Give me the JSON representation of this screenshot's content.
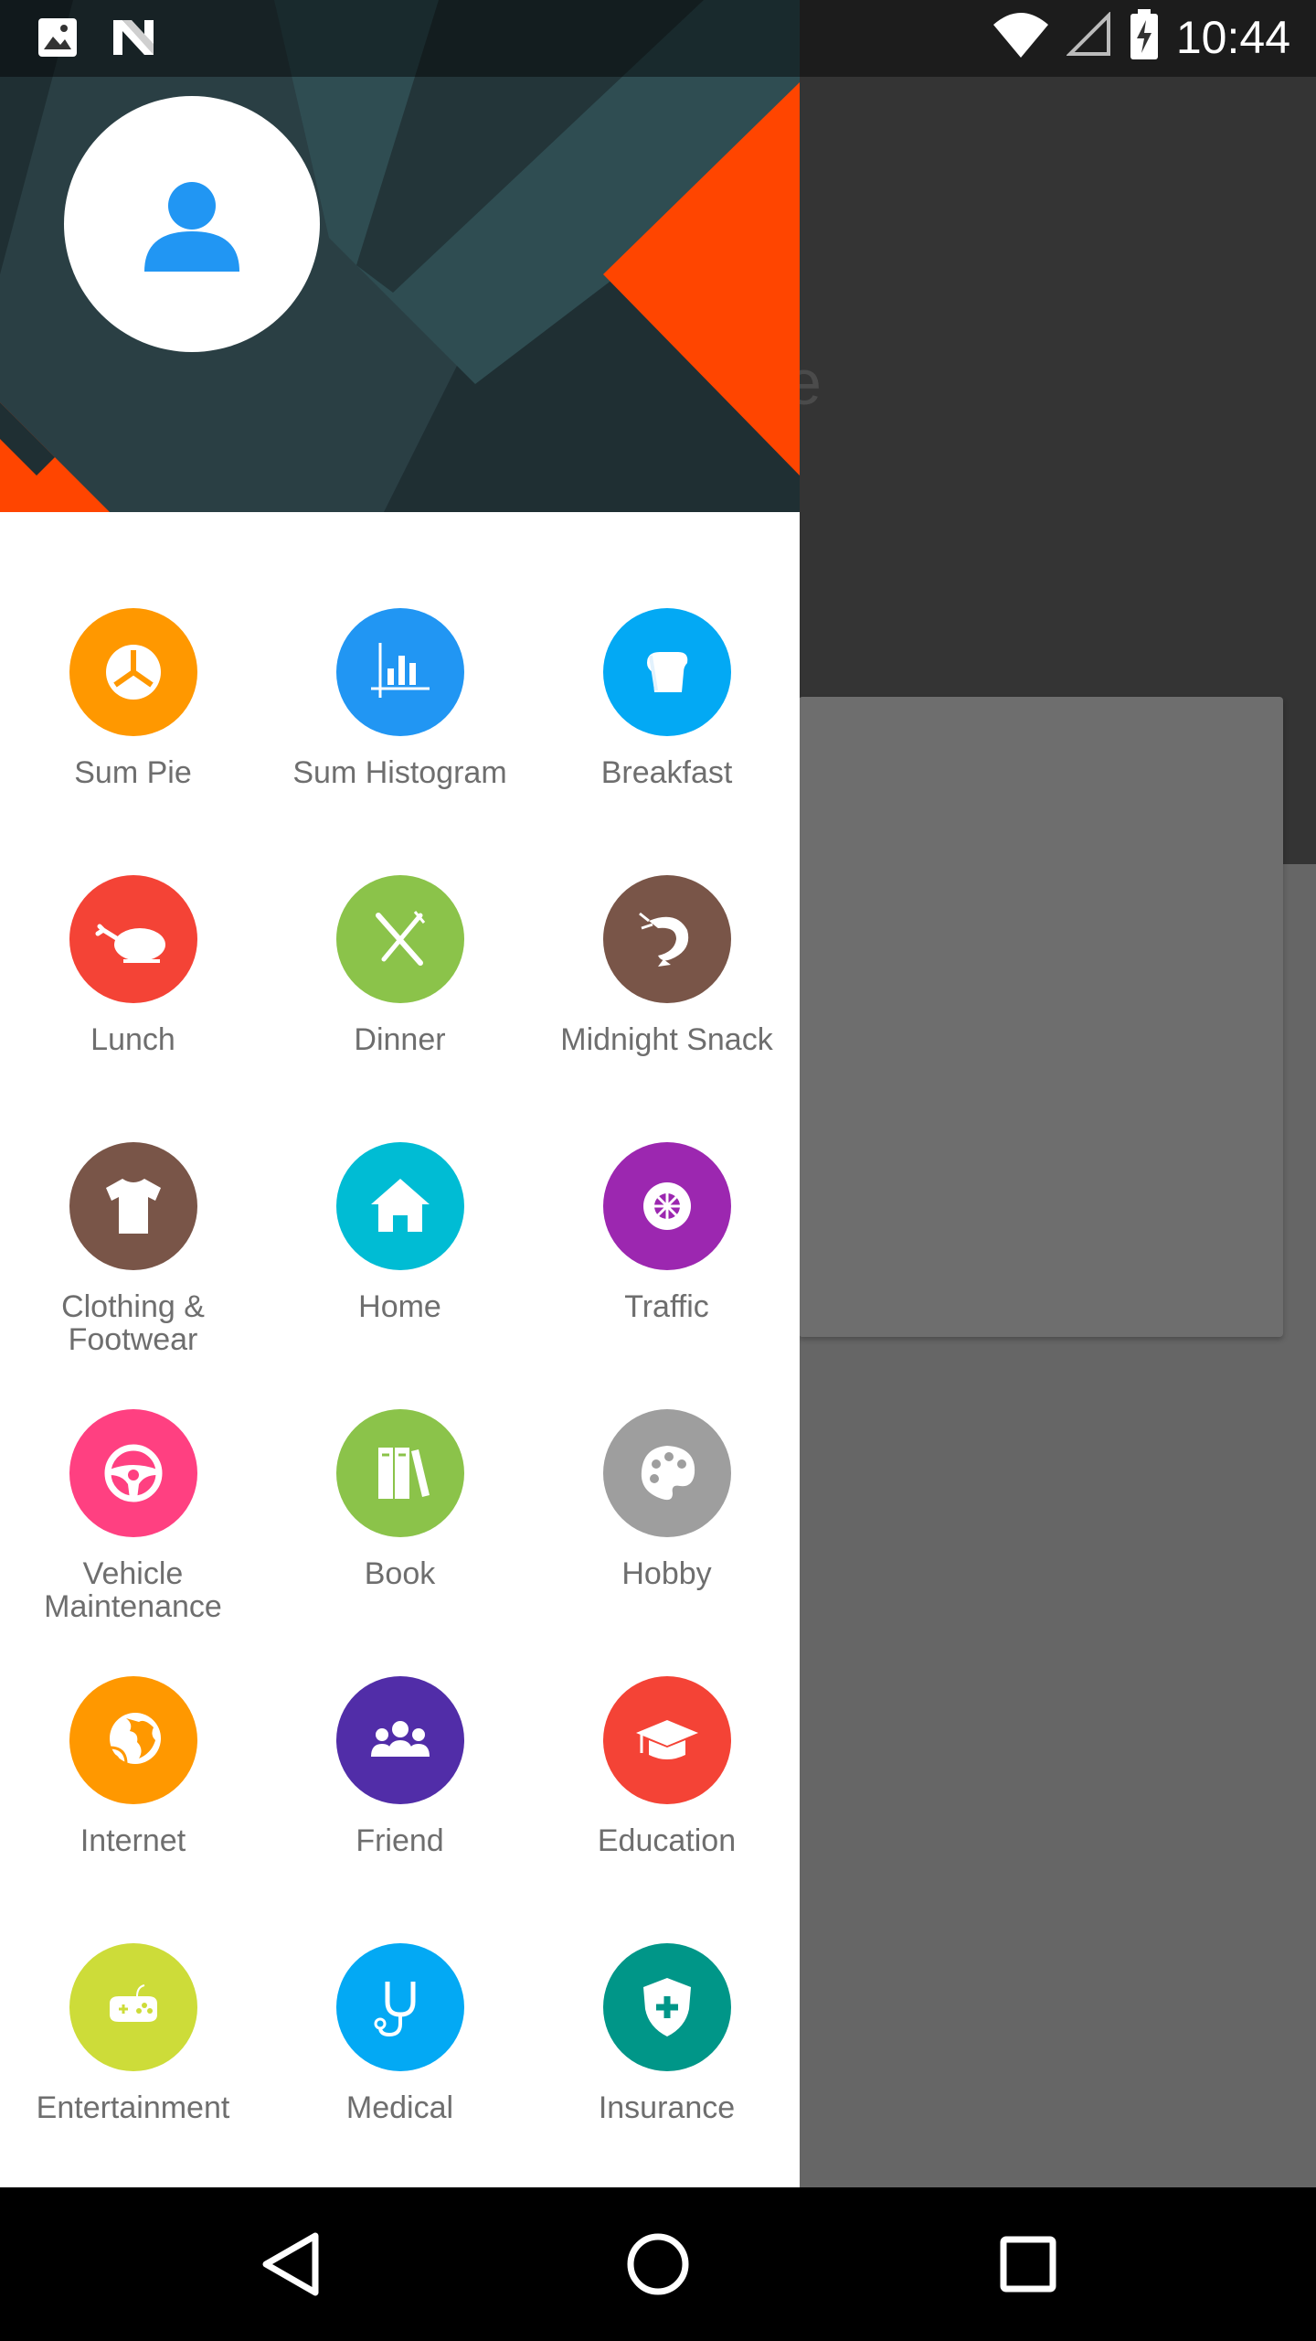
{
  "status_bar": {
    "time": "10:44",
    "left_icons": [
      "image-icon",
      "n-logo-icon"
    ],
    "right_icons": [
      "wifi-icon",
      "cellular-signal-icon",
      "battery-charging-icon"
    ]
  },
  "drawer": {
    "header": {
      "avatar_icon": "person-icon",
      "colors": {
        "dark": "#263a3e",
        "mid": "#2f4d52",
        "accent": "#ff4500"
      }
    },
    "categories": [
      {
        "label": "Sum Pie",
        "icon": "pie-chart-icon",
        "color": "#ff9800"
      },
      {
        "label": "Sum Histogram",
        "icon": "histogram-icon",
        "color": "#2196f3"
      },
      {
        "label": "Breakfast",
        "icon": "toast-icon",
        "color": "#03a9f4"
      },
      {
        "label": "Lunch",
        "icon": "chicken-icon",
        "color": "#f44336"
      },
      {
        "label": "Dinner",
        "icon": "fork-knife-icon",
        "color": "#8bc34a"
      },
      {
        "label": "Midnight Snack",
        "icon": "shrimp-icon",
        "color": "#795548"
      },
      {
        "label": "Clothing & Footwear",
        "icon": "tshirt-icon",
        "color": "#795548"
      },
      {
        "label": "Home",
        "icon": "house-icon",
        "color": "#00bcd4"
      },
      {
        "label": "Traffic",
        "icon": "wheel-icon",
        "color": "#9c27b0"
      },
      {
        "label": "Vehicle Maintenance",
        "icon": "steering-wheel-icon",
        "color": "#ff4081"
      },
      {
        "label": "Book",
        "icon": "books-icon",
        "color": "#8bc34a"
      },
      {
        "label": "Hobby",
        "icon": "palette-icon",
        "color": "#9e9e9e"
      },
      {
        "label": "Internet",
        "icon": "globe-icon",
        "color": "#ff9800"
      },
      {
        "label": "Friend",
        "icon": "group-icon",
        "color": "#512da8"
      },
      {
        "label": "Education",
        "icon": "graduation-cap-icon",
        "color": "#f44336"
      },
      {
        "label": "Entertainment",
        "icon": "gamepad-icon",
        "color": "#cddc39"
      },
      {
        "label": "Medical",
        "icon": "stethoscope-icon",
        "color": "#03a9f4"
      },
      {
        "label": "Insurance",
        "icon": "shield-plus-icon",
        "color": "#009688"
      }
    ]
  },
  "background": {
    "toolbar_color": "#343434",
    "page_color": "#666666",
    "card_color": "#6e6e6e"
  },
  "nav_bar": {
    "buttons": [
      "back-icon",
      "home-circle-icon",
      "recents-icon"
    ]
  }
}
